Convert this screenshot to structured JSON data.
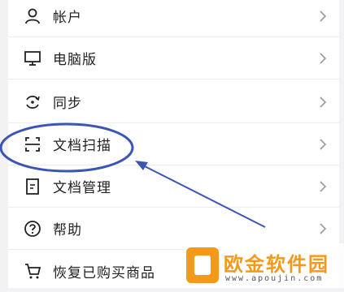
{
  "menu": {
    "items": [
      {
        "label": "帐户",
        "icon": "person-icon"
      },
      {
        "label": "电脑版",
        "icon": "monitor-icon"
      },
      {
        "label": "同步",
        "icon": "sync-icon"
      },
      {
        "label": "文档扫描",
        "icon": "scan-icon"
      },
      {
        "label": "文档管理",
        "icon": "document-icon"
      },
      {
        "label": "帮助",
        "icon": "help-icon"
      },
      {
        "label": "恢复已购买商品",
        "icon": "cart-icon"
      }
    ]
  },
  "annotation": {
    "color": "#3a55b5",
    "highlighted_item": "文档扫描"
  },
  "watermark": {
    "brand_text": "欧金软件园",
    "url": "www.apoujin.com",
    "color": "#f39a1d"
  }
}
